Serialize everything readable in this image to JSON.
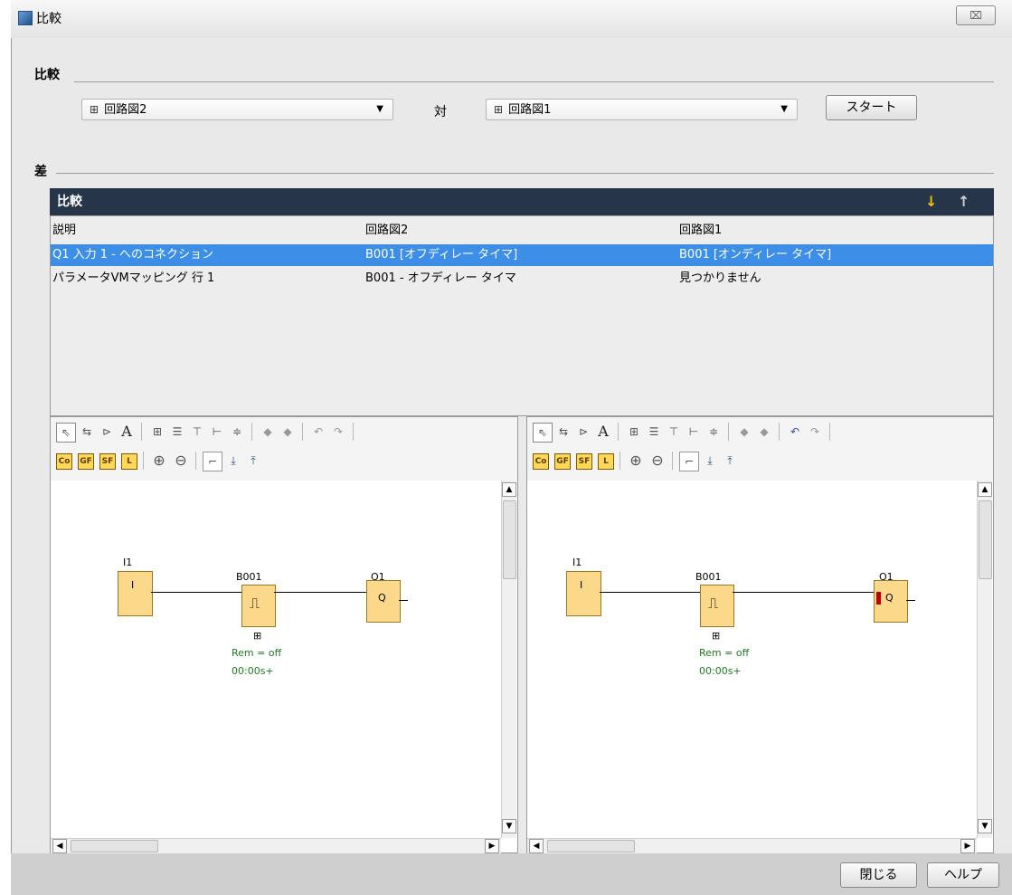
{
  "window": {
    "title": "比較",
    "close": "⌧"
  },
  "compare_section": {
    "label": "比較",
    "left_select": {
      "value": "回路図2"
    },
    "vs_label": "対",
    "right_select": {
      "value": "回路図1"
    },
    "start_button": "スタート"
  },
  "diff_section": {
    "label": "差",
    "table": {
      "title": "比較",
      "nav_down": "↓",
      "nav_up": "↑",
      "columns": [
        "説明",
        "回路図2",
        "回路図1"
      ],
      "rows": [
        {
          "desc": "Q1 入力 1 - へのコネクション",
          "left": "B001 [オフディレー タイマ]",
          "right": "B001 [オンディレー タイマ]",
          "selected": true
        },
        {
          "desc": "パラメータVMマッピング 行 1",
          "left": "B001 - オフディレー タイマ",
          "right": "見つかりません",
          "selected": false
        }
      ]
    }
  },
  "toolbar": {
    "row1": [
      "⇖",
      "⇆",
      "⊳",
      "A",
      "⊞",
      "☰",
      "⊤",
      "⊢",
      "≑",
      "◆",
      "◆",
      "↶",
      "↷"
    ],
    "row2": [
      "Co",
      "GF",
      "SF",
      "L"
    ],
    "zoom_in": "⊕",
    "zoom_out": "⊖",
    "b1": "⌐",
    "b2": "⤓",
    "b3": "⤒"
  },
  "left_diagram": {
    "input_name": "I1",
    "input_text": "I",
    "block_name": "B001",
    "output_name": "Q1",
    "output_text": "Q",
    "param1": "Rem = off",
    "param2": "00:00s+",
    "expand": "⊞"
  },
  "right_diagram": {
    "input_name": "I1",
    "input_text": "I",
    "block_name": "B001",
    "output_name": "Q1",
    "output_text": "Q",
    "param1": "Rem = off",
    "param2": "00:00s+",
    "expand": "⊞"
  },
  "footer": {
    "close_button": "閉じる",
    "help_button": "ヘルプ"
  },
  "colors": {
    "selection": "#3d8ee6",
    "table_header": "#263549",
    "block_fill": "#fcd88a",
    "param_text": "#1f7a1f"
  }
}
